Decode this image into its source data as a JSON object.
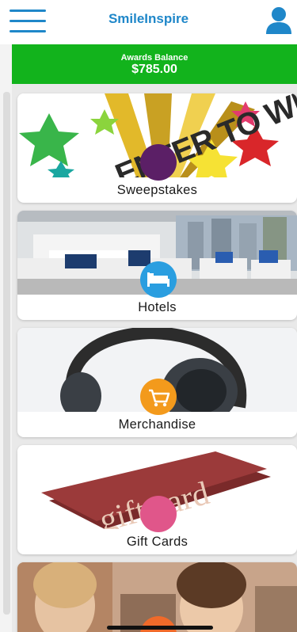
{
  "header": {
    "title": "SmileInspire",
    "menu_icon": "hamburger-menu-icon",
    "user_icon": "user-icon",
    "color": "#1f87c9"
  },
  "balance": {
    "label": "Awards Balance",
    "amount": "$785.00",
    "color": "#12b31c"
  },
  "categories": [
    {
      "label": "Sweepstakes",
      "image_text": "ENTER TO WIN!",
      "badge_color": "#5b1f66"
    },
    {
      "label": "Hotels",
      "icon": "bed-icon",
      "badge_color": "#2a9ee0"
    },
    {
      "label": "Merchandise",
      "icon": "shopping-cart-icon",
      "badge_color": "#f39a1c"
    },
    {
      "label": "Gift Cards",
      "image_text": "gift card",
      "badge_color": "#e0568a"
    },
    {
      "badge_color": "#f06a2a"
    }
  ]
}
